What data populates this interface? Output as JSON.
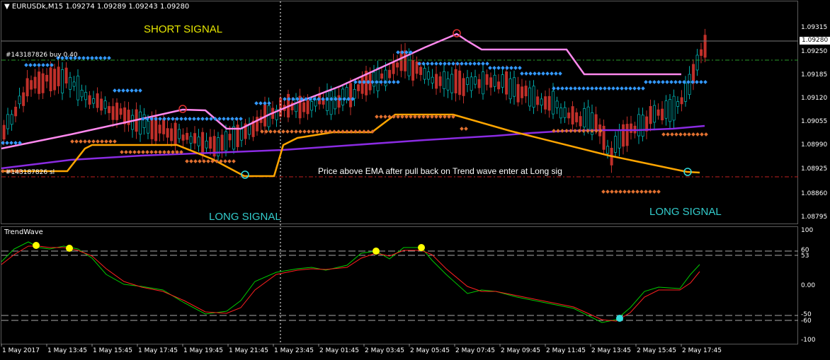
{
  "chart_header": {
    "symbol_line": "EURUSDk,M15  1.09274 1.09289 1.09243 1.09280"
  },
  "annotations": {
    "short_signal": "SHORT SIGNAL",
    "long_signal_1": "LONG SIGNAL",
    "long_signal_2": "LONG SIGNAL",
    "note": "Price above EMA after pull back on Trend wave enter at Long sig",
    "order_buy": "#143187826 buy 0.40",
    "order_sl": "#143187826 sl"
  },
  "price_axis": {
    "labels": [
      "1.09315",
      "1.09250",
      "1.09185",
      "1.09120",
      "1.09055",
      "1.08990",
      "1.08925",
      "1.08860",
      "1.08795"
    ],
    "current": "1.09280"
  },
  "indicator": {
    "name": "TrendWave",
    "axis_labels": [
      "100",
      "60",
      "53",
      "0.00",
      "-50",
      "-60",
      "-100"
    ]
  },
  "time_axis": {
    "labels": [
      "1 May 2017",
      "1 May 13:45",
      "1 May 15:45",
      "1 May 17:45",
      "1 May 19:45",
      "1 May 21:45",
      "1 May 23:45",
      "2 May 01:45",
      "2 May 03:45",
      "2 May 05:45",
      "2 May 07:45",
      "2 May 09:45",
      "2 May 11:45",
      "2 May 13:45",
      "2 May 15:45",
      "2 May 17:45"
    ]
  },
  "colors": {
    "bull_candle": "#00aaaa",
    "bear_candle": "#c0302a",
    "ema_purple": "#8a2be2",
    "pink_line": "#ff88ee",
    "orange_line": "#ffa500",
    "blue_dots": "#3399ff",
    "orange_dots": "#e07030",
    "wave_green": "#00cc00",
    "wave_red": "#ff2020",
    "yellow_signal": "#ffff00",
    "cyan_signal": "#33dddd"
  }
}
